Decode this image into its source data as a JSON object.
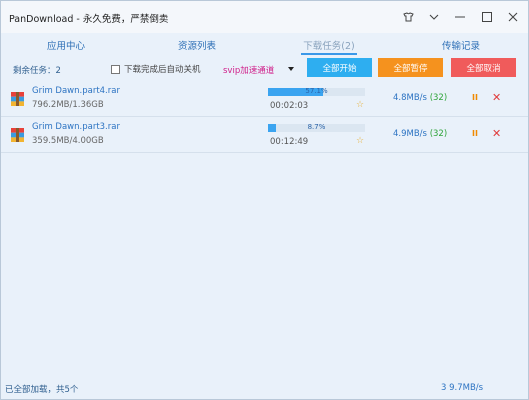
{
  "window": {
    "title": "PanDownload - 永久免费，严禁倒卖"
  },
  "nav": {
    "tabs": [
      {
        "label": "应用中心"
      },
      {
        "label": "资源列表"
      },
      {
        "label": "下载任务(2)"
      },
      {
        "label": "传输记录"
      }
    ]
  },
  "toolbar": {
    "remaining": "剩余任务：2",
    "auto_shutdown": "下载完成后自动关机",
    "svip_channel": "svip加速通道",
    "start_all": "全部开始",
    "pause_all": "全部暂停",
    "cancel_all": "全部取消",
    "colors": {
      "start_all": "#2eaef0",
      "pause_all": "#f5921e",
      "cancel_all": "#f05b5b"
    }
  },
  "downloads": [
    {
      "name": "Grim Dawn.part4.rar",
      "size": "796.2MB/1.36GB",
      "progress_text": "57.1%",
      "progress": 0.571,
      "time": "00:02:03",
      "speed": "4.8MB/s",
      "speed_count": "(32)"
    },
    {
      "name": "Grim Dawn.part3.rar",
      "size": "359.5MB/4.00GB",
      "progress_text": "8.7%",
      "progress": 0.087,
      "time": "00:12:49",
      "speed": "4.9MB/s",
      "speed_count": "(32)"
    }
  ],
  "status": {
    "left": "已全部加载，共5个",
    "right": "3   9.7MB/s"
  }
}
